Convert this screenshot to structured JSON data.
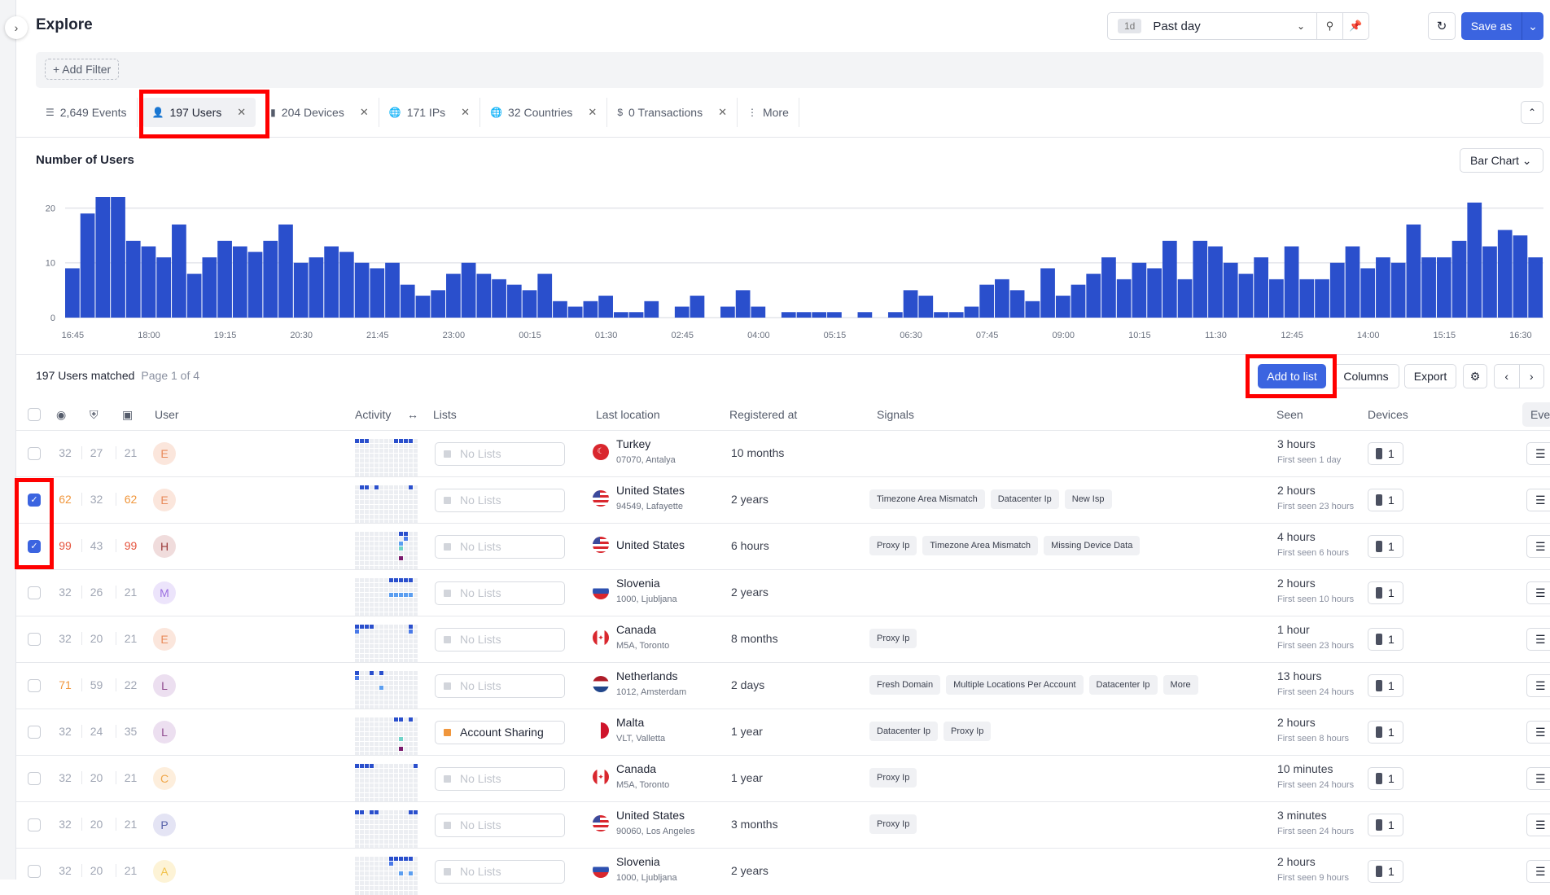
{
  "header": {
    "title": "Explore",
    "range_badge": "1d",
    "range_label": "Past day",
    "save_as": "Save as"
  },
  "filter": {
    "add_filter": "+ Add Filter"
  },
  "tabs": [
    {
      "label": "2,649 Events",
      "icon": "list-icon",
      "closable": false,
      "active": false
    },
    {
      "label": "197 Users",
      "icon": "user-icon",
      "closable": true,
      "active": true
    },
    {
      "label": "204 Devices",
      "icon": "device-icon",
      "closable": true,
      "active": false
    },
    {
      "label": "171 IPs",
      "icon": "globe-icon",
      "closable": true,
      "active": false
    },
    {
      "label": "32 Countries",
      "icon": "globe-icon",
      "closable": true,
      "active": false
    },
    {
      "label": "0 Transactions",
      "icon": "dollar-icon",
      "closable": true,
      "active": false
    },
    {
      "label": "More",
      "icon": "more-vertical-icon",
      "closable": false,
      "active": false
    }
  ],
  "chart_panel": {
    "title": "Number of Users",
    "type_select": "Bar Chart"
  },
  "chart_data": {
    "type": "bar",
    "title": "Number of Users",
    "xlabel": "",
    "ylabel": "",
    "ylim": [
      0,
      22
    ],
    "yticks": [
      0,
      10,
      20
    ],
    "grid": true,
    "bar_color": "#2a4fcc",
    "tick_labels": [
      "16:45",
      "18:00",
      "19:15",
      "20:30",
      "21:45",
      "23:00",
      "00:15",
      "01:30",
      "02:45",
      "04:00",
      "05:15",
      "06:30",
      "07:45",
      "09:00",
      "10:15",
      "11:30",
      "12:45",
      "14:00",
      "15:15",
      "16:30"
    ],
    "interval_minutes": 15,
    "values": [
      9,
      19,
      22,
      22,
      14,
      13,
      11,
      17,
      8,
      11,
      14,
      13,
      12,
      14,
      17,
      10,
      11,
      13,
      12,
      10,
      9,
      10,
      6,
      4,
      5,
      8,
      10,
      8,
      7,
      6,
      5,
      8,
      3,
      2,
      3,
      4,
      1,
      1,
      3,
      0,
      2,
      4,
      0,
      2,
      5,
      2,
      0,
      1,
      1,
      1,
      1,
      0,
      1,
      0,
      1,
      5,
      4,
      1,
      1,
      2,
      6,
      7,
      5,
      3,
      9,
      4,
      6,
      8,
      11,
      7,
      10,
      9,
      14,
      7,
      14,
      13,
      10,
      8,
      11,
      7,
      13,
      7,
      7,
      10,
      13,
      9,
      11,
      10,
      17,
      11,
      11,
      14,
      21,
      13,
      16,
      15,
      11
    ]
  },
  "table": {
    "matched": "197 Users matched",
    "page": "Page 1 of 4",
    "actions": {
      "add_to_list": "Add to list",
      "columns": "Columns",
      "export": "Export"
    },
    "headers": {
      "user": "User",
      "activity": "Activity",
      "lists": "Lists",
      "location": "Last location",
      "registered": "Registered at",
      "signals": "Signals",
      "seen": "Seen",
      "devices": "Devices",
      "events": "Eve"
    },
    "colors": {
      "dark": "#2a4fcc",
      "mid": "#4a7ae8",
      "light": "#5b9ef0",
      "teal": "#6fd3c8",
      "purple": "#7a1a6e",
      "orange": "#f0963c",
      "red": "#e5533d"
    },
    "rows": [
      {
        "checked": false,
        "s1": "32",
        "s2": "27",
        "s3": "21",
        "lvl": "",
        "avatar": "E",
        "av": [
          "#fbe6dc",
          "#e88a5a"
        ],
        "act": [
          [
            0,
            0,
            "dark"
          ],
          [
            0,
            1,
            "dark"
          ],
          [
            0,
            2,
            "dark"
          ],
          [
            0,
            8,
            "dark"
          ],
          [
            0,
            9,
            "dark"
          ],
          [
            0,
            10,
            "dark"
          ],
          [
            0,
            11,
            "dark"
          ]
        ],
        "list": "No Lists",
        "has_list": false,
        "flag": "tr",
        "country": "Turkey",
        "city": "07070, Antalya",
        "registered": "10 months",
        "signals": [],
        "seen": "3 hours",
        "first": "First seen 1 day",
        "devices": "1"
      },
      {
        "checked": true,
        "s1": "62",
        "s2": "32",
        "s3": "62",
        "lvl": "orange",
        "avatar": "E",
        "av": [
          "#fbe6dc",
          "#e88a5a"
        ],
        "act": [
          [
            0,
            1,
            "dark"
          ],
          [
            0,
            2,
            "dark"
          ],
          [
            0,
            4,
            "dark"
          ],
          [
            0,
            11,
            "dark"
          ]
        ],
        "list": "No Lists",
        "has_list": false,
        "flag": "us",
        "country": "United States",
        "city": "94549, Lafayette",
        "registered": "2 years",
        "signals": [
          "Timezone Area Mismatch",
          "Datacenter Ip",
          "New Isp"
        ],
        "seen": "2 hours",
        "first": "First seen 23 hours",
        "devices": "1"
      },
      {
        "checked": true,
        "s1": "99",
        "s2": "43",
        "s3": "99",
        "lvl": "red",
        "avatar": "H",
        "av": [
          "#f0dcdc",
          "#9b3a3a"
        ],
        "act": [
          [
            0,
            9,
            "dark"
          ],
          [
            0,
            10,
            "dark"
          ],
          [
            1,
            10,
            "mid"
          ],
          [
            2,
            9,
            "light"
          ],
          [
            3,
            9,
            "teal"
          ],
          [
            5,
            9,
            "purple"
          ]
        ],
        "list": "No Lists",
        "has_list": false,
        "flag": "us",
        "country": "United States",
        "city": "",
        "registered": "6 hours",
        "signals": [
          "Proxy Ip",
          "Timezone Area Mismatch",
          "Missing Device Data"
        ],
        "seen": "4 hours",
        "first": "First seen 6 hours",
        "devices": "1"
      },
      {
        "checked": false,
        "s1": "32",
        "s2": "26",
        "s3": "21",
        "lvl": "",
        "avatar": "M",
        "av": [
          "#ece4fb",
          "#9b6fe0"
        ],
        "act": [
          [
            0,
            7,
            "dark"
          ],
          [
            0,
            8,
            "dark"
          ],
          [
            0,
            9,
            "dark"
          ],
          [
            0,
            10,
            "dark"
          ],
          [
            0,
            11,
            "dark"
          ],
          [
            3,
            7,
            "light"
          ],
          [
            3,
            8,
            "light"
          ],
          [
            3,
            9,
            "light"
          ],
          [
            3,
            10,
            "light"
          ],
          [
            3,
            11,
            "light"
          ]
        ],
        "list": "No Lists",
        "has_list": false,
        "flag": "si",
        "country": "Slovenia",
        "city": "1000, Ljubljana",
        "registered": "2 years",
        "signals": [],
        "seen": "2 hours",
        "first": "First seen 10 hours",
        "devices": "1"
      },
      {
        "checked": false,
        "s1": "32",
        "s2": "20",
        "s3": "21",
        "lvl": "",
        "avatar": "E",
        "av": [
          "#fbe6dc",
          "#e88a5a"
        ],
        "act": [
          [
            0,
            0,
            "dark"
          ],
          [
            0,
            1,
            "dark"
          ],
          [
            0,
            2,
            "dark"
          ],
          [
            0,
            3,
            "dark"
          ],
          [
            0,
            11,
            "dark"
          ],
          [
            1,
            0,
            "mid"
          ],
          [
            1,
            11,
            "mid"
          ]
        ],
        "list": "No Lists",
        "has_list": false,
        "flag": "ca",
        "country": "Canada",
        "city": "M5A, Toronto",
        "registered": "8 months",
        "signals": [
          "Proxy Ip"
        ],
        "seen": "1 hour",
        "first": "First seen 23 hours",
        "devices": "1"
      },
      {
        "checked": false,
        "s1": "71",
        "s2": "59",
        "s3": "22",
        "lvl": "orange1",
        "avatar": "L",
        "av": [
          "#ecdff0",
          "#8e4a8e"
        ],
        "act": [
          [
            0,
            0,
            "dark"
          ],
          [
            0,
            3,
            "dark"
          ],
          [
            0,
            5,
            "dark"
          ],
          [
            1,
            0,
            "mid"
          ],
          [
            3,
            5,
            "light"
          ]
        ],
        "list": "No Lists",
        "has_list": false,
        "flag": "nl",
        "country": "Netherlands",
        "city": "1012, Amsterdam",
        "registered": "2 days",
        "signals": [
          "Fresh Domain",
          "Multiple Locations Per Account",
          "Datacenter Ip",
          "More"
        ],
        "seen": "13 hours",
        "first": "First seen 24 hours",
        "devices": "1"
      },
      {
        "checked": false,
        "s1": "32",
        "s2": "24",
        "s3": "35",
        "lvl": "",
        "avatar": "L",
        "av": [
          "#ecdff0",
          "#8e4a8e"
        ],
        "act": [
          [
            0,
            8,
            "dark"
          ],
          [
            0,
            9,
            "dark"
          ],
          [
            0,
            11,
            "dark"
          ],
          [
            4,
            9,
            "teal"
          ],
          [
            6,
            9,
            "purple"
          ]
        ],
        "list": "Account Sharing",
        "has_list": true,
        "flag": "mt",
        "country": "Malta",
        "city": "VLT, Valletta",
        "registered": "1 year",
        "signals": [
          "Datacenter Ip",
          "Proxy Ip"
        ],
        "seen": "2 hours",
        "first": "First seen 8 hours",
        "devices": "1"
      },
      {
        "checked": false,
        "s1": "32",
        "s2": "20",
        "s3": "21",
        "lvl": "",
        "avatar": "C",
        "av": [
          "#fdeedc",
          "#f0a74a"
        ],
        "act": [
          [
            0,
            0,
            "dark"
          ],
          [
            0,
            1,
            "dark"
          ],
          [
            0,
            2,
            "dark"
          ],
          [
            0,
            3,
            "dark"
          ],
          [
            0,
            12,
            "dark"
          ]
        ],
        "list": "No Lists",
        "has_list": false,
        "flag": "ca",
        "country": "Canada",
        "city": "M5A, Toronto",
        "registered": "1 year",
        "signals": [
          "Proxy Ip"
        ],
        "seen": "10 minutes",
        "first": "First seen 24 hours",
        "devices": "1"
      },
      {
        "checked": false,
        "s1": "32",
        "s2": "20",
        "s3": "21",
        "lvl": "",
        "avatar": "P",
        "av": [
          "#e4e4f4",
          "#5560a8"
        ],
        "act": [
          [
            0,
            0,
            "dark"
          ],
          [
            0,
            1,
            "dark"
          ],
          [
            0,
            3,
            "dark"
          ],
          [
            0,
            4,
            "dark"
          ],
          [
            0,
            11,
            "dark"
          ],
          [
            0,
            12,
            "dark"
          ]
        ],
        "list": "No Lists",
        "has_list": false,
        "flag": "us",
        "country": "United States",
        "city": "90060, Los Angeles",
        "registered": "3 months",
        "signals": [
          "Proxy Ip"
        ],
        "seen": "3 minutes",
        "first": "First seen 24 hours",
        "devices": "1"
      },
      {
        "checked": false,
        "s1": "32",
        "s2": "20",
        "s3": "21",
        "lvl": "",
        "avatar": "A",
        "av": [
          "#fdf3d6",
          "#f2c24a"
        ],
        "act": [
          [
            0,
            7,
            "dark"
          ],
          [
            0,
            8,
            "dark"
          ],
          [
            0,
            9,
            "dark"
          ],
          [
            0,
            10,
            "dark"
          ],
          [
            0,
            11,
            "dark"
          ],
          [
            1,
            7,
            "mid"
          ],
          [
            3,
            9,
            "light"
          ],
          [
            3,
            11,
            "light"
          ]
        ],
        "list": "No Lists",
        "has_list": false,
        "flag": "si",
        "country": "Slovenia",
        "city": "1000, Ljubljana",
        "registered": "2 years",
        "signals": [],
        "seen": "2 hours",
        "first": "First seen 9 hours",
        "devices": "1"
      }
    ]
  }
}
